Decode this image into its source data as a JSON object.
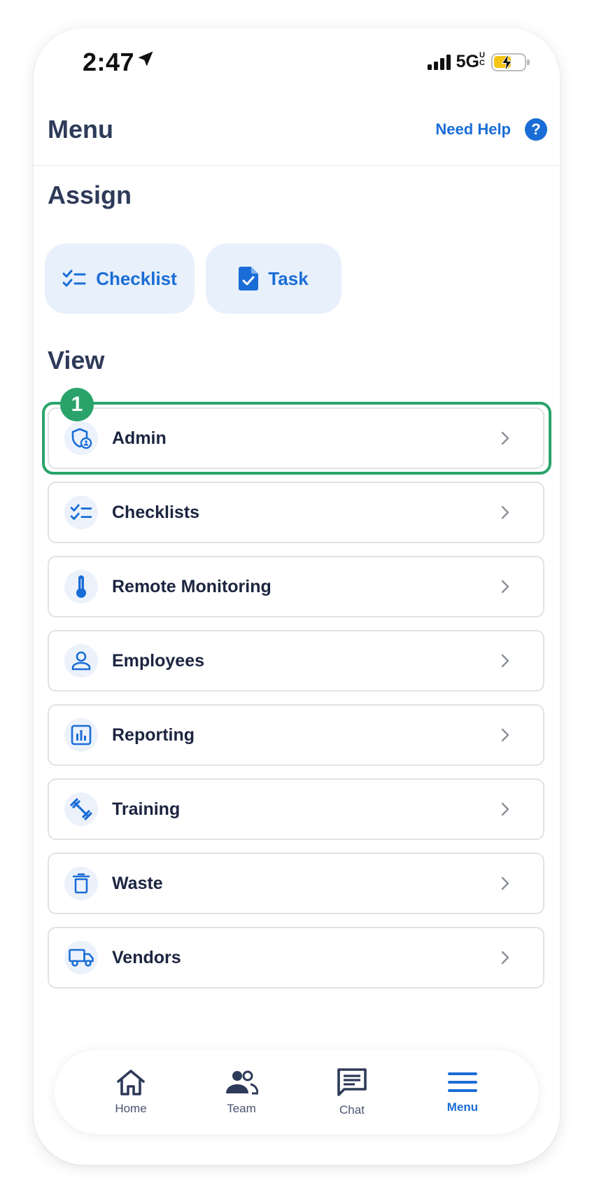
{
  "status_bar": {
    "time": "2:47",
    "network": "5G",
    "network_suffix": "UC"
  },
  "header": {
    "title": "Menu",
    "help_label": "Need Help",
    "help_icon": "?"
  },
  "assign": {
    "title": "Assign",
    "buttons": [
      {
        "label": "Checklist",
        "icon": "checklist-icon"
      },
      {
        "label": "Task",
        "icon": "task-document-icon"
      }
    ]
  },
  "view": {
    "title": "View",
    "items": [
      {
        "label": "Admin",
        "icon": "admin-shield-icon"
      },
      {
        "label": "Checklists",
        "icon": "checklist-icon"
      },
      {
        "label": "Remote Monitoring",
        "icon": "thermometer-icon"
      },
      {
        "label": "Employees",
        "icon": "person-icon"
      },
      {
        "label": "Reporting",
        "icon": "bar-chart-icon"
      },
      {
        "label": "Training",
        "icon": "dumbbell-icon"
      },
      {
        "label": "Waste",
        "icon": "trash-icon"
      },
      {
        "label": "Vendors",
        "icon": "truck-icon"
      }
    ]
  },
  "annotation": {
    "badge": "1"
  },
  "nav": [
    {
      "label": "Home",
      "icon": "home-icon"
    },
    {
      "label": "Team",
      "icon": "team-icon"
    },
    {
      "label": "Chat",
      "icon": "chat-icon"
    },
    {
      "label": "Menu",
      "icon": "hamburger-menu-icon",
      "active": true
    }
  ],
  "colors": {
    "accent": "#1a6dd6",
    "heading": "#2e3a59",
    "highlight": "#2aa36b",
    "assign_bg": "#e7f0fb"
  }
}
